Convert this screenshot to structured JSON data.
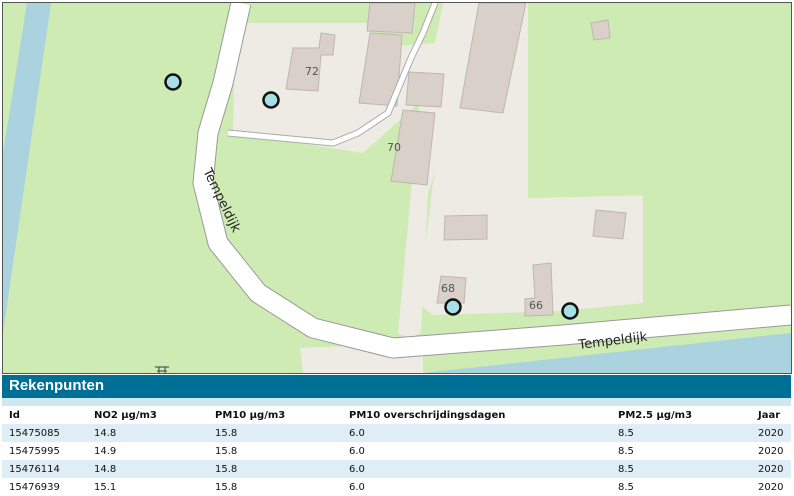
{
  "map": {
    "road_label_vertical": "Tempeldijk",
    "road_label_horizontal": "Tempeldijk",
    "house_numbers": [
      "72",
      "70",
      "68",
      "66"
    ],
    "colors": {
      "grass": "#cdebb2",
      "built": "#eeebe4",
      "building": "#d8d0c9",
      "water": "#aad3df",
      "road": "#ffffff",
      "marker_fill": "#a6dfe6"
    }
  },
  "panel": {
    "title": "Rekenpunten",
    "columns": [
      "Id",
      "NO2 µg/m3",
      "PM10 µg/m3",
      "PM10 overschrijdingsdagen",
      "PM2.5 µg/m3",
      "Jaar"
    ],
    "rows": [
      [
        "15475085",
        "14.8",
        "15.8",
        "6.0",
        "8.5",
        "2020"
      ],
      [
        "15475995",
        "14.9",
        "15.8",
        "6.0",
        "8.5",
        "2020"
      ],
      [
        "15476114",
        "14.8",
        "15.8",
        "6.0",
        "8.5",
        "2020"
      ],
      [
        "15476939",
        "15.1",
        "15.8",
        "6.0",
        "8.5",
        "2020"
      ]
    ]
  }
}
